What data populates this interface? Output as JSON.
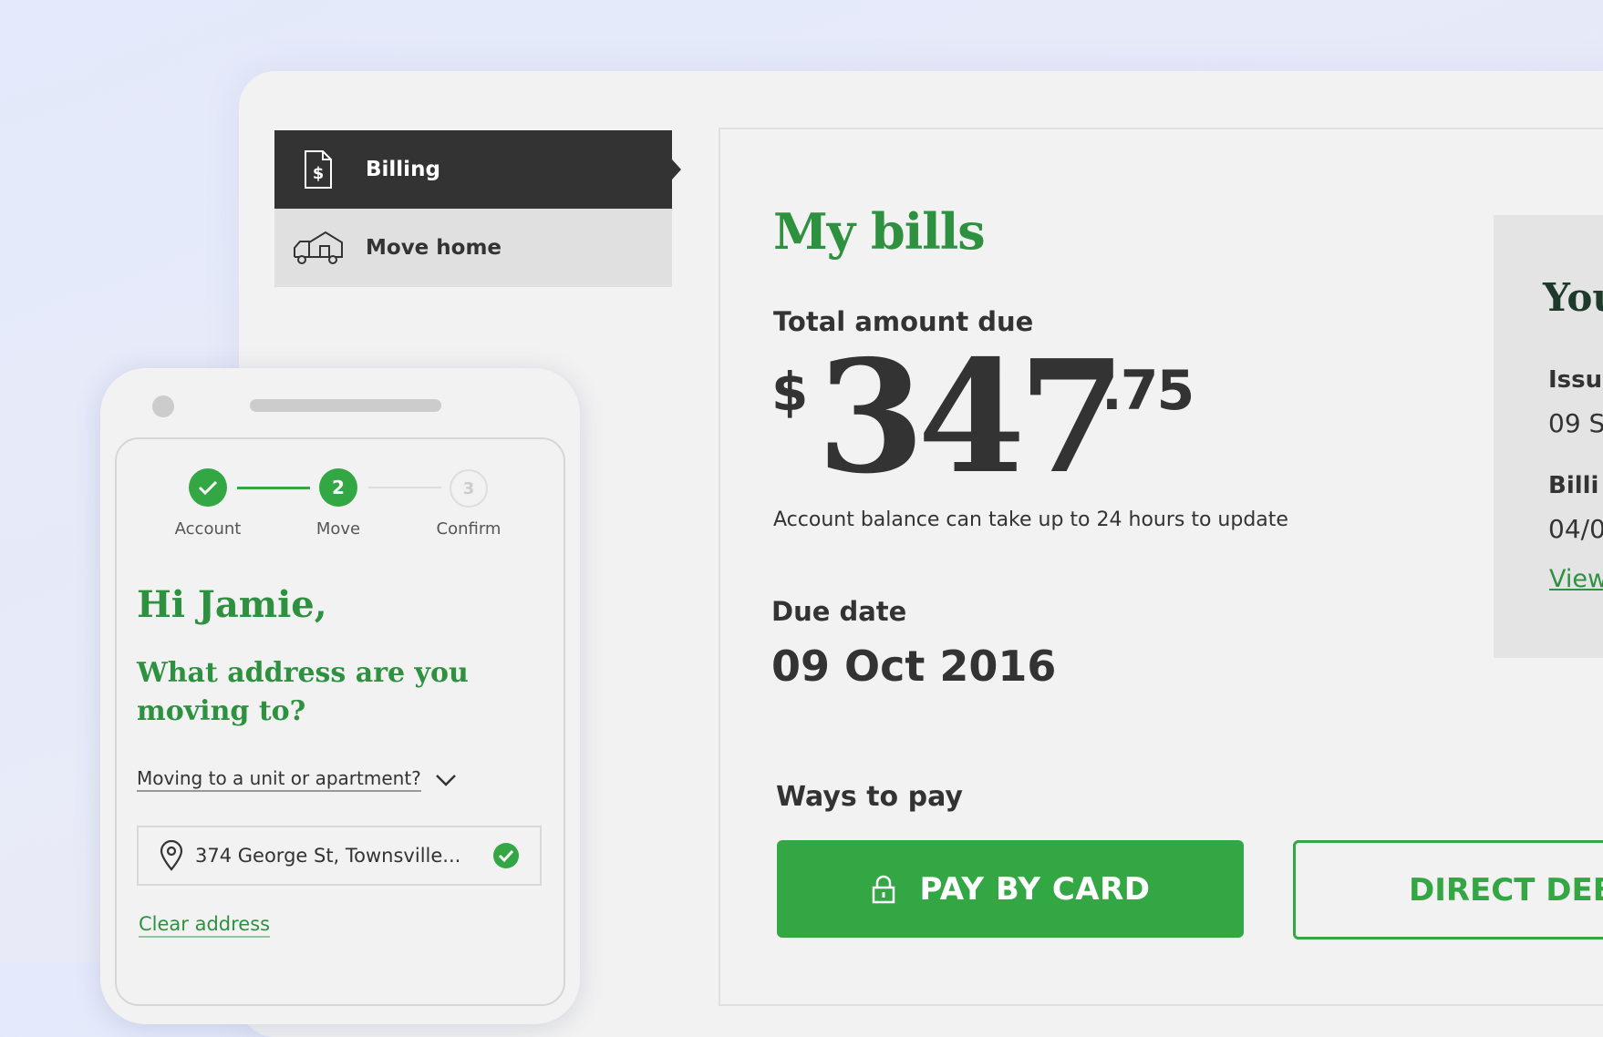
{
  "desktop": {
    "nav": {
      "items": [
        {
          "label": "Billing",
          "icon": "billing-document-icon",
          "active": true
        },
        {
          "label": "Move home",
          "icon": "moving-truck-icon",
          "active": false
        }
      ]
    },
    "main": {
      "title": "My bills",
      "total_label": "Total amount due",
      "amount": {
        "currency": "$",
        "whole": "347",
        "cents": ".75"
      },
      "balance_note": "Account balance can take up to 24 hours to update",
      "due_label": "Due date",
      "due_value": "09 Oct 2016",
      "ways_label": "Ways to pay",
      "pay_card_label": "PAY BY CARD",
      "direct_debit_label": "DIRECT DEB"
    },
    "side": {
      "title": "You",
      "issue_label": "Issue",
      "issue_value": "09 S",
      "billing_label": "Billi",
      "billing_value": "04/0",
      "view_link": "View"
    }
  },
  "phone": {
    "steps": [
      {
        "label": "Account",
        "number": "",
        "state": "done"
      },
      {
        "label": "Move",
        "number": "2",
        "state": "current"
      },
      {
        "label": "Confirm",
        "number": "3",
        "state": "upcoming"
      }
    ],
    "greeting": "Hi Jamie,",
    "question": "What address are you moving to?",
    "unit_toggle": "Moving to a unit or apartment?",
    "address_value": "374 George St, Townsville...",
    "clear_link": "Clear address"
  },
  "colors": {
    "brand_green": "#34a745",
    "text_green": "#2e9140",
    "dark": "#333333"
  }
}
